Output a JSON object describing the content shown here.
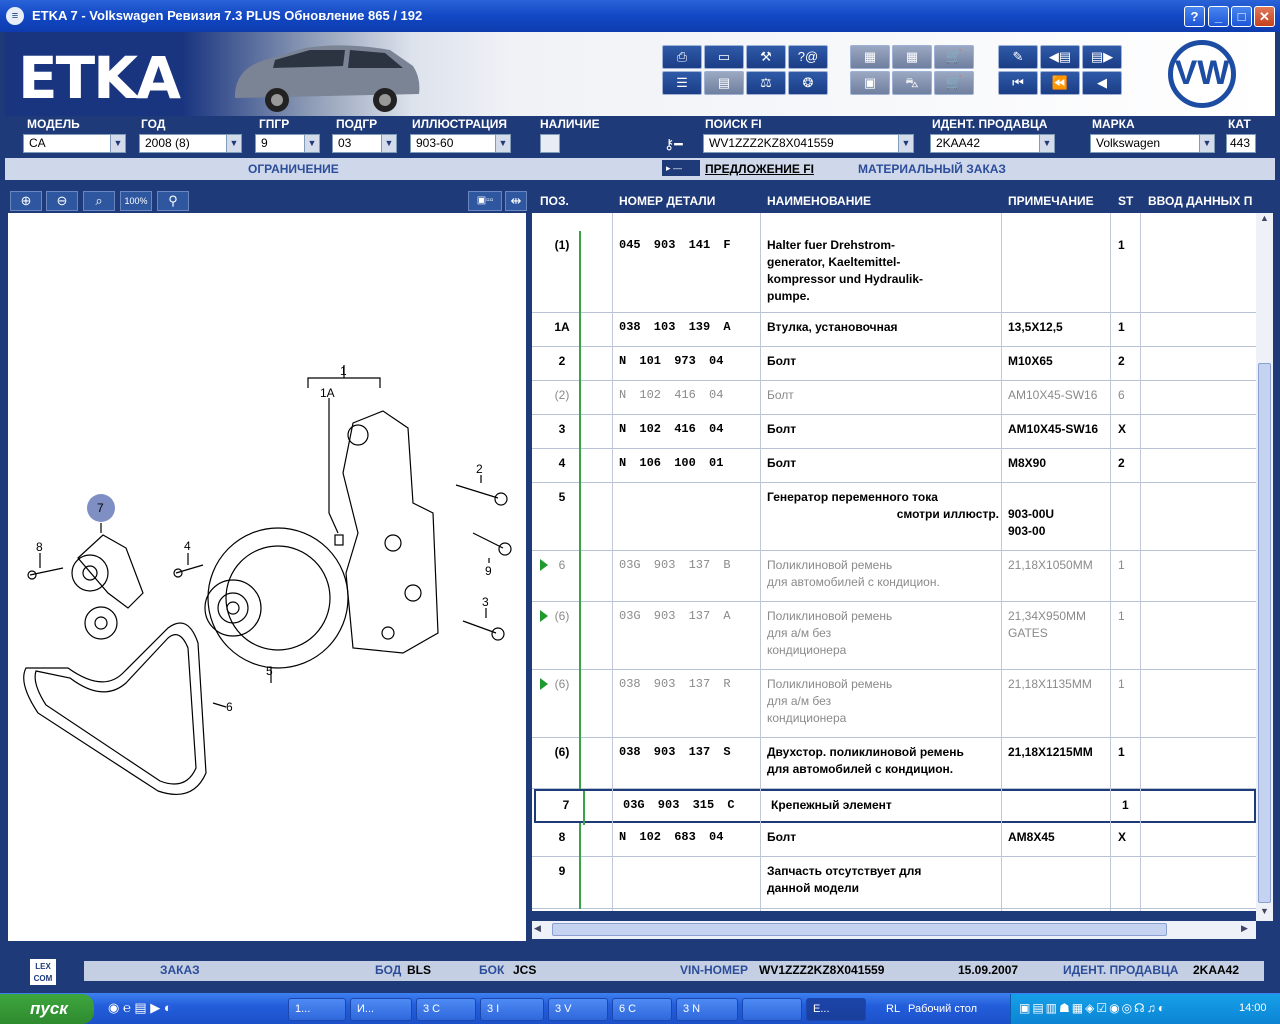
{
  "window": {
    "title": "ETKA 7 - Volkswagen Ревизия 7.3 PLUS Обновление 865 / 192",
    "help": "?",
    "minimize": "_",
    "maximize": "□",
    "close": "✕"
  },
  "banner": {
    "logo": "ETKA",
    "brand_logo": "VW"
  },
  "selectors": [
    {
      "label": "МОДЕЛЬ",
      "value": "CA"
    },
    {
      "label": "ГОД",
      "value": "2008 (8)"
    },
    {
      "label": "ГПГР",
      "value": "9"
    },
    {
      "label": "ПОДГР",
      "value": "03"
    },
    {
      "label": "ИЛЛЮСТРАЦИЯ",
      "value": "903-60"
    },
    {
      "label": "НАЛИЧИЕ",
      "value": ""
    },
    {
      "label": "ПОИСК FI",
      "value": "WV1ZZZ2KZ8X041559"
    },
    {
      "label": "ИДЕНТ. ПРОДАВЦА",
      "value": "2KAA42"
    },
    {
      "label": "МАРКА",
      "value": "Volkswagen"
    },
    {
      "label": "КАТ",
      "value": "443"
    }
  ],
  "links": {
    "restriction": "ОГРАНИЧЕНИЕ",
    "fi_offer": "ПРЕДЛОЖЕНИЕ FI",
    "material_order": "МАТЕРИАЛЬНЫЙ ЗАКАЗ"
  },
  "columns": [
    "ПОЗ.",
    "НОМЕР ДЕТАЛИ",
    "НАИМЕНОВАНИЕ",
    "ПРИМЕЧАНИЕ",
    "ST",
    "ВВОД ДАННЫХ П"
  ],
  "rows": [
    {
      "pos": "(1)",
      "part": "045 903 141 F",
      "name": [
        "Halter fuer Drehstrom-",
        "generator, Kaeltemittel-",
        "kompressor und Hydraulik-",
        "pumpe."
      ],
      "note": [],
      "st": "1",
      "grey": false,
      "arrow": false
    },
    {
      "pos": "1A",
      "part": "038 103 139 A",
      "name": [
        "Втулка, установочная"
      ],
      "note": [
        "13,5X12,5"
      ],
      "st": "1",
      "grey": false,
      "arrow": false
    },
    {
      "pos": "2",
      "part": "N   101 973 04",
      "name": [
        "Болт"
      ],
      "note": [
        "M10X65"
      ],
      "st": "2",
      "grey": false,
      "arrow": false
    },
    {
      "pos": "(2)",
      "part": "N   102 416 04",
      "name": [
        "Болт"
      ],
      "note": [
        "AM10X45-SW16"
      ],
      "st": "6",
      "grey": true,
      "arrow": false
    },
    {
      "pos": "3",
      "part": "N   102 416 04",
      "name": [
        "Болт"
      ],
      "note": [
        "AM10X45-SW16"
      ],
      "st": "X",
      "grey": false,
      "arrow": false
    },
    {
      "pos": "4",
      "part": "N   106 100 01",
      "name": [
        "Болт"
      ],
      "note": [
        "M8X90"
      ],
      "st": "2",
      "grey": false,
      "arrow": false
    },
    {
      "pos": "5",
      "part": "",
      "name": [
        "Генератор переменного тока",
        "смотри иллюстр."
      ],
      "note": [
        "",
        "903-00U",
        "903-00"
      ],
      "st": "",
      "grey": false,
      "arrow": false
    },
    {
      "pos": "6",
      "part": "03G 903 137 B",
      "name": [
        "Поликлиновой ремень",
        "для автомобилей с кондицион."
      ],
      "note": [
        "21,18X1050MM"
      ],
      "st": "1",
      "grey": true,
      "arrow": true
    },
    {
      "pos": "(6)",
      "part": "03G 903 137 A",
      "name": [
        "Поликлиновой ремень",
        "для а/м без",
        "кондиционера"
      ],
      "note": [
        "21,34X950MM",
        "GATES"
      ],
      "st": "1",
      "grey": true,
      "arrow": true
    },
    {
      "pos": "(6)",
      "part": "038 903 137 R",
      "name": [
        "Поликлиновой ремень",
        "для а/м без",
        "кондиционера"
      ],
      "note": [
        "21,18X1135MM"
      ],
      "st": "1",
      "grey": true,
      "arrow": true
    },
    {
      "pos": "(6)",
      "part": "038 903 137 S",
      "name": [
        "Двухстор. поликлиновой ремень",
        "для автомобилей с кондицион."
      ],
      "note": [
        "21,18X1215MM"
      ],
      "st": "1",
      "grey": false,
      "arrow": false
    },
    {
      "pos": "7",
      "part": "03G 903 315 C",
      "name": [
        "Крепежный элемент"
      ],
      "note": [],
      "st": "1",
      "grey": false,
      "arrow": false,
      "selected": true
    },
    {
      "pos": "8",
      "part": "N   102 683 04",
      "name": [
        "Болт"
      ],
      "note": [
        "AM8X45"
      ],
      "st": "X",
      "grey": false,
      "arrow": false
    },
    {
      "pos": "9",
      "part": "",
      "name": [
        "Запчасть отсутствует для",
        "данной модели"
      ],
      "note": [],
      "st": "",
      "grey": false,
      "arrow": false
    }
  ],
  "illustration": {
    "callouts": [
      "1",
      "1A",
      "2",
      "3",
      "4",
      "5",
      "6",
      "7",
      "8",
      "9"
    ],
    "highlighted": "7"
  },
  "status": {
    "lexcom": "LEX COM",
    "order": "ЗАКАЗ",
    "bod_label": "БОД",
    "bod_value": "BLS",
    "box_label": "БОК",
    "box_value": "JCS",
    "vin_label": "VIN-НОМЕР",
    "vin_value": "WV1ZZZ2KZ8X041559",
    "date": "15.09.2007",
    "dealer_label": "ИДЕНТ. ПРОДАВЦА",
    "dealer_value": "2KAA42"
  },
  "taskbar": {
    "start": "пуск",
    "tasks": [
      "1...",
      "И...",
      "3 С",
      "3 I",
      "3 V",
      "6 С",
      "3 N",
      "",
      "E..."
    ],
    "lang": "RL",
    "desktop": "Рабочий стол",
    "clock": "14:00"
  }
}
